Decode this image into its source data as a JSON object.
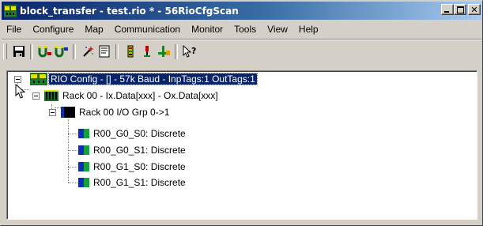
{
  "window": {
    "title": "block_transfer - test.rio * - 56RioCfgScan"
  },
  "menu": [
    "File",
    "Configure",
    "Map",
    "Communication",
    "Monitor",
    "Tools",
    "View",
    "Help"
  ],
  "toolbar": {
    "buttons": [
      "save-icon",
      "connect-icon",
      "disconnect-icon",
      "wand-icon",
      "properties-icon",
      "module-icon",
      "plug-icon",
      "branch-icon",
      "help-pointer-icon"
    ]
  },
  "tree": {
    "root": "RIO Config - [] - 57k Baud - InpTags:1 OutTags:1",
    "rack": "Rack 00 - Ix.Data[xxx] - Ox.Data[xxx]",
    "group": "Rack 00 I/O Grp 0->1",
    "items": [
      "R00_G0_S0: Discrete",
      "R00_G0_S1: Discrete",
      "R00_G1_S0: Discrete",
      "R00_G1_S1: Discrete"
    ]
  },
  "colors": {
    "selection": "#0a246a",
    "title_gradient_start": "#0a246a",
    "title_gradient_end": "#a6caf0"
  }
}
